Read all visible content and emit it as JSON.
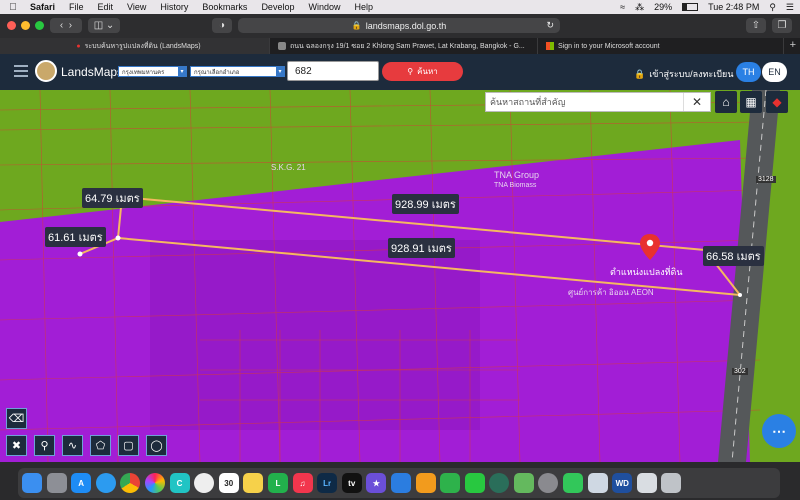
{
  "menubar": {
    "app": "Safari",
    "items": [
      "File",
      "Edit",
      "View",
      "History",
      "Bookmarks",
      "Develop",
      "Window",
      "Help"
    ],
    "battery": "29%",
    "time": "Tue 2:48 PM"
  },
  "browser": {
    "url": "landsmaps.dol.go.th",
    "tabs": [
      {
        "title": "ระบบค้นหารูปแปลงที่ดิน (LandsMaps)",
        "active": true
      },
      {
        "title": "ถนน ฉลองกรุง 19/1 ซอย 2 Khlong Sam Prawet, Lat Krabang, Bangkok - G...",
        "active": false
      },
      {
        "title": "Sign in to your Microsoft account",
        "active": false
      }
    ]
  },
  "app": {
    "brand": "LandsMaps",
    "province": "กรุงเทพมหานคร",
    "district": "กรุณาเลือกอำเภอ",
    "parcel_number": "682",
    "search_label": "ค้นหา",
    "login_label": "เข้าสู่ระบบ/ลงทะเบียน",
    "lang_th": "TH",
    "lang_en": "EN"
  },
  "map": {
    "search_placeholder": "ค้นหาสถานที่สำคัญ",
    "clear_label": "✕",
    "parcel_label": "ตำแหน่งแปลงที่ดิน",
    "pois": [
      "S.K.G. 21",
      "TNA Group",
      "TNA Biomass",
      "ศูนย์การค้า อิออน AEON"
    ],
    "road_numbers": [
      "3128",
      "302"
    ],
    "measurements": {
      "north_side": "928.99 เมตร",
      "south_side": "928.91 เมตร",
      "west_top": "64.79 เมตร",
      "west_bottom": "61.61 เมตร",
      "east_side": "66.58 เมตร"
    },
    "colors": {
      "zone_purple": "#a21ed6",
      "zone_green": "#6ea81f",
      "boundary": "#f5b860",
      "pin": "#e8312f"
    }
  },
  "dock": [
    "Finder",
    "Launchpad",
    "App Store",
    "Safari",
    "Chrome",
    "Photos",
    "Canva",
    "Music Player",
    "Calendar",
    "Notes",
    "LINE",
    "Music",
    "Lightroom",
    "Apple TV",
    "iMovie",
    "Keynote",
    "Pages",
    "Numbers",
    "FaceTime",
    "Time Machine",
    "Maps",
    "Settings",
    "Messages",
    "Preview",
    "WD Drive",
    "Downloads",
    "Trash"
  ]
}
